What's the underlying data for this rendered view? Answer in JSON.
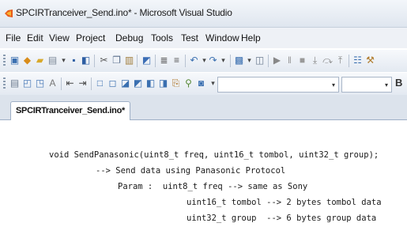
{
  "window": {
    "title": "SPCIRTranceiver_Send.ino* - Microsoft Visual Studio",
    "app_icon": "visual-studio-icon"
  },
  "menu": {
    "items": [
      "File",
      "Edit",
      "View",
      "Project",
      "Debug",
      "Tools",
      "Test",
      "Window",
      "Help"
    ]
  },
  "toolbar1": {
    "icons": [
      "add-project-icon",
      "new-project-icon",
      "open-folder-icon",
      "add-item-icon",
      "save-icon",
      "save-all-icon",
      "cut-icon",
      "copy-icon",
      "paste-icon",
      "find-icon",
      "align-left-icon",
      "align-right-icon",
      "undo-icon",
      "redo-icon",
      "navigate-icon",
      "solution-config-icon",
      "start-debug-icon",
      "pause-icon",
      "stop-icon",
      "step-into-icon",
      "step-over-icon",
      "step-out-icon",
      "properties-icon"
    ]
  },
  "toolbar2": {
    "icons": [
      "html-view-icon",
      "design-icon",
      "split-icon",
      "format-icon",
      "outdent-icon",
      "indent-icon",
      "comment-icon",
      "uncomment-icon",
      "bookmark-icon",
      "next-bookmark-icon",
      "prev-bookmark-icon",
      "clear-bookmarks-icon",
      "zoom-icon"
    ],
    "bold_label": "B"
  },
  "tabs": [
    {
      "label": "SPCIRTranceiver_Send.ino*",
      "active": true
    }
  ],
  "editor": {
    "lines": [
      "void SendPanasonic(uint8_t freq, uint16_t tombol, uint32_t group);",
      "--> Send data using Panasonic Protocol",
      "Param :  uint8_t freq --> same as Sony",
      "uint16_t tombol --> 2 bytes tombol data",
      "uint32_t group  --> 6 bytes group data"
    ]
  },
  "colors": {
    "accent": "#3c5a8c",
    "titlebar": "#e6ecf3",
    "editor_bg": "#ffffff"
  }
}
